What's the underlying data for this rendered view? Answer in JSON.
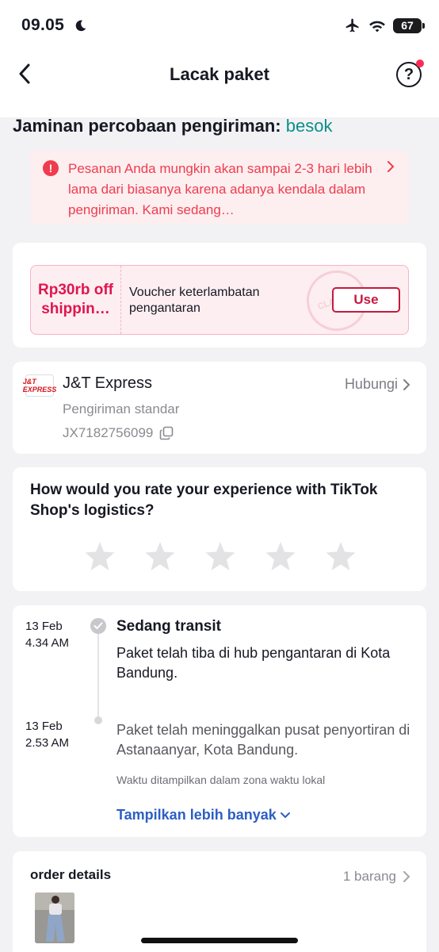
{
  "status_bar": {
    "time": "09.05",
    "battery": "67"
  },
  "header": {
    "title": "Lacak paket",
    "help_label": "?"
  },
  "guarantee": {
    "label": "Jaminan percobaan pengiriman:",
    "date": "besok"
  },
  "alert": {
    "icon_label": "!",
    "message": "Pesanan Anda mungkin akan sampai 2-3 hari lebih lama dari biasanya karena adanya kendala dalam pengiriman. Kami sedang…"
  },
  "voucher": {
    "amount": "Rp30rb off shippin…",
    "description": "Voucher keterlambatan pengantaran",
    "stamp_text": "CLAIMED",
    "use_label": "Use"
  },
  "courier": {
    "logo_text": "J&T EXPRESS",
    "name": "J&T Express",
    "contact_label": "Hubungi",
    "service": "Pengiriman standar",
    "tracking_number": "JX7182756099"
  },
  "rating": {
    "question": "How would you rate your experience with TikTok Shop's logistics?",
    "stars": 0,
    "max_stars": 5
  },
  "timeline": {
    "events": [
      {
        "date": "13 Feb",
        "time": "4.34 AM",
        "status": "Sedang transit",
        "description": "Paket telah tiba di hub pengantaran di Kota Bandung."
      },
      {
        "date": "13 Feb",
        "time": "2.53 AM",
        "status": "",
        "description": "Paket telah meninggalkan pusat penyortiran di Astanaanyar, Kota Bandung."
      }
    ],
    "timezone_note": "Waktu ditampilkan dalam zona waktu lokal",
    "show_more_label": "Tampilkan lebih banyak"
  },
  "order": {
    "title": "order details",
    "count_label": "1 barang"
  },
  "colors": {
    "accent_red": "#ee3d4d",
    "voucher_red": "#c5193e",
    "date_teal": "#0a8f8a",
    "link_blue": "#2c5ec4"
  }
}
